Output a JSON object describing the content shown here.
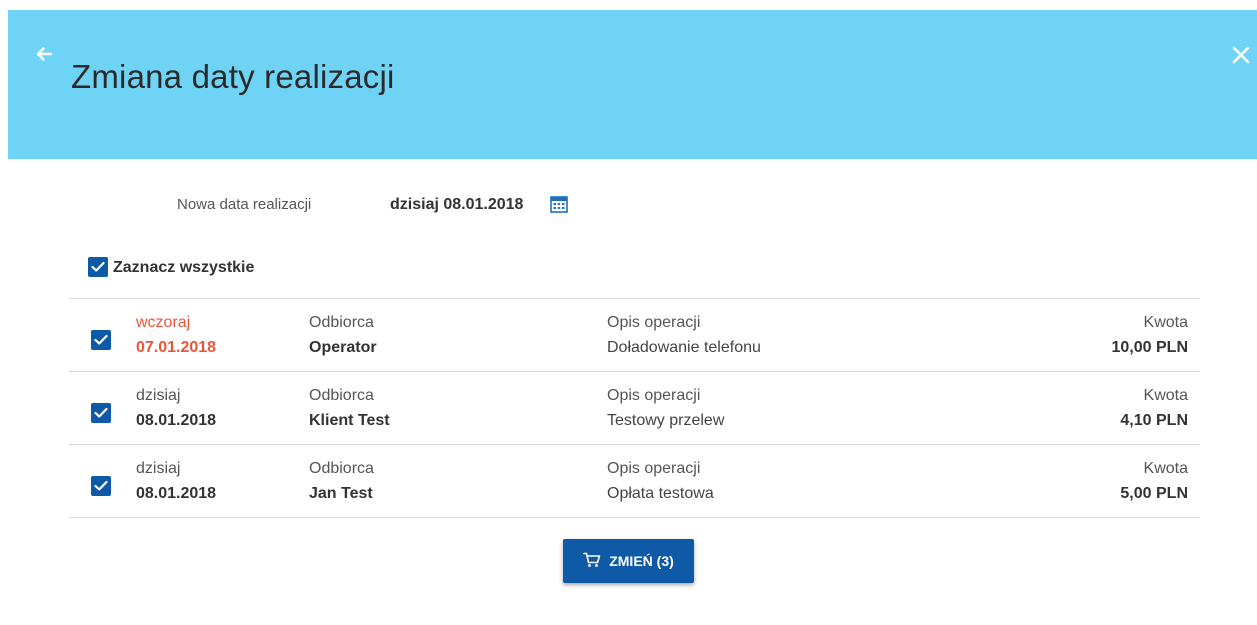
{
  "header": {
    "title": "Zmiana daty realizacji",
    "back_icon": "arrow-left-icon",
    "close_icon": "close-icon",
    "background_color": "#6fd3f5"
  },
  "date_selector": {
    "label": "Nowa data realizacji",
    "value": "dzisiaj 08.01.2018",
    "icon": "calendar-icon"
  },
  "select_all": {
    "label": "Zaznacz wszystkie",
    "checked": true
  },
  "transactions": [
    {
      "checked": true,
      "day_label": "wczoraj",
      "date": "07.01.2018",
      "recipient_label": "Odbiorca",
      "recipient": "Operator",
      "description_label": "Opis operacji",
      "description": "Doładowanie telefonu",
      "amount_label": "Kwota",
      "amount": "10,00 PLN",
      "date_color": "#e8563a"
    },
    {
      "checked": true,
      "day_label": "dzisiaj",
      "date": "08.01.2018",
      "recipient_label": "Odbiorca",
      "recipient": "Klient Test",
      "description_label": "Opis operacji",
      "description": "Testowy przelew",
      "amount_label": "Kwota",
      "amount": "4,10 PLN"
    },
    {
      "checked": true,
      "day_label": "dzisiaj",
      "date": "08.01.2018",
      "recipient_label": "Odbiorca",
      "recipient": "Jan Test",
      "description_label": "Opis operacji",
      "description": "Opłata testowa",
      "amount_label": "Kwota",
      "amount": "5,00 PLN"
    }
  ],
  "submit_button": {
    "label": "ZMIEŃ (3)",
    "icon": "cart-icon",
    "color": "#0f5aa6"
  }
}
